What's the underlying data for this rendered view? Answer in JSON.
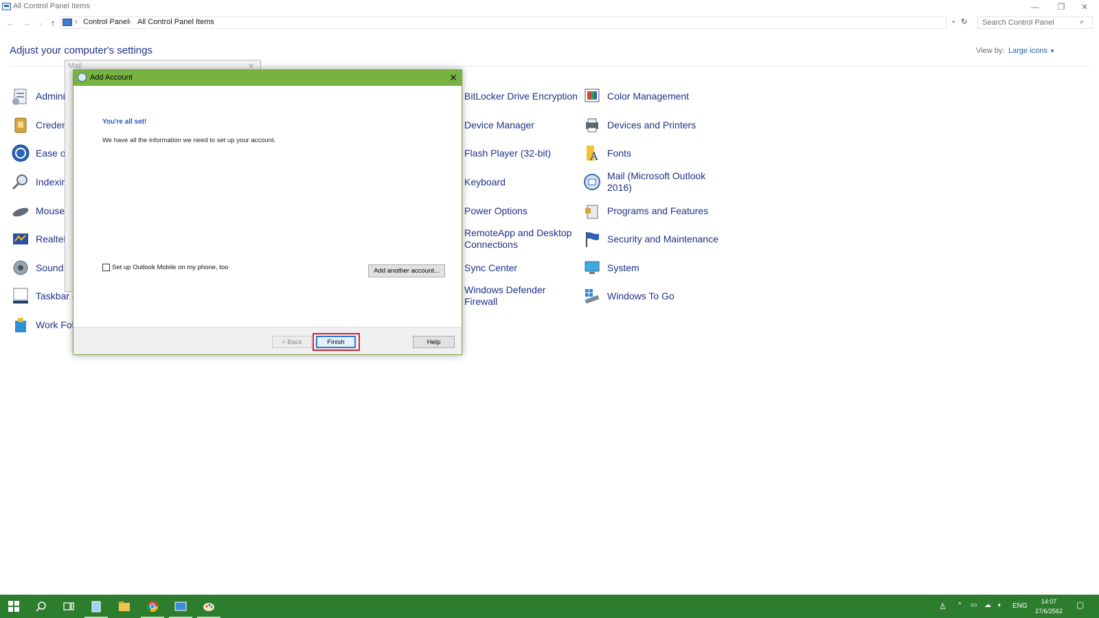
{
  "window": {
    "title": "All Control Panel Items",
    "minimize": "—",
    "restore": "❐",
    "close": "✕"
  },
  "address_bar": {
    "breadcrumbs": [
      "Control Panel",
      "All Control Panel Items"
    ],
    "search_placeholder": "Search Control Panel"
  },
  "header": {
    "title": "Adjust your computer's settings",
    "view_by_label": "View by:",
    "view_by_value": "Large icons"
  },
  "items_col1": [
    {
      "label": "Admini",
      "icon": "admin-tools-icon"
    },
    {
      "label": "Creden",
      "icon": "credential-manager-icon"
    },
    {
      "label": "Ease of",
      "icon": "ease-of-access-icon"
    },
    {
      "label": "Indexin",
      "icon": "indexing-options-icon"
    },
    {
      "label": "Mouse",
      "icon": "mouse-icon"
    },
    {
      "label": "Realtek",
      "icon": "realtek-audio-icon"
    },
    {
      "label": "Sound",
      "icon": "sound-icon"
    },
    {
      "label": "Taskbar a",
      "icon": "taskbar-icon"
    },
    {
      "label": "Work Fol",
      "icon": "work-folders-icon"
    }
  ],
  "items_col3": [
    {
      "label": "BitLocker Drive Encryption"
    },
    {
      "label": "Device Manager"
    },
    {
      "label": "Flash Player (32-bit)"
    },
    {
      "label": "Keyboard"
    },
    {
      "label": "Power Options"
    },
    {
      "label": "RemoteApp and Desktop Connections"
    },
    {
      "label": "Sync Center"
    },
    {
      "label": "Windows Defender Firewall"
    }
  ],
  "items_col4": [
    {
      "label": "Color Management",
      "icon": "color-management-icon"
    },
    {
      "label": "Devices and Printers",
      "icon": "devices-printers-icon"
    },
    {
      "label": "Fonts",
      "icon": "fonts-icon"
    },
    {
      "label": "Mail (Microsoft Outlook 2016)",
      "icon": "mail-icon"
    },
    {
      "label": "Programs and Features",
      "icon": "programs-features-icon"
    },
    {
      "label": "Security and Maintenance",
      "icon": "security-flag-icon"
    },
    {
      "label": "System",
      "icon": "system-icon"
    },
    {
      "label": "Windows To Go",
      "icon": "windows-to-go-icon"
    }
  ],
  "mail_dialog": {
    "title": "Mail"
  },
  "add_account_dialog": {
    "title": "Add Account",
    "heading": "You're all set!",
    "message": "We have all the information we need to set up your account.",
    "checkbox_label": "Set up Outlook Mobile on my phone, too",
    "checkbox_checked": false,
    "add_another_label": "Add another account...",
    "back_label": "< Back",
    "finish_label": "Finish",
    "help_label": "Help"
  },
  "taskbar": {
    "language": "ENG",
    "time": "14:07",
    "date": "27/6/2562"
  },
  "colors": {
    "dialog_header": "#78b342",
    "taskbar": "#2d7d2e",
    "link": "#1e3287",
    "highlight": "#d7202a"
  }
}
